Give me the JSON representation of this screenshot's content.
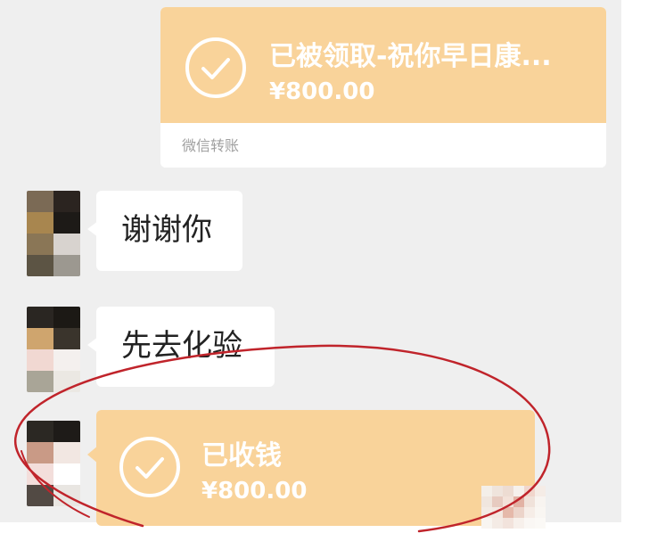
{
  "messages": {
    "sent_transfer": {
      "title": "已被领取-祝你早日康...",
      "amount": "¥800.00",
      "footer_label": "微信转账",
      "icon": "check-circle-icon"
    },
    "text_1": "谢谢你",
    "text_2": "先去化验",
    "received_transfer": {
      "title": "已收钱",
      "amount": "¥800.00",
      "icon": "check-circle-icon"
    }
  },
  "colors": {
    "chat_background": "#efefef",
    "transfer_card": "#f9d39a",
    "bubble": "#ffffff",
    "annotation": "#c0242b",
    "muted_text": "#9f9f9f"
  }
}
